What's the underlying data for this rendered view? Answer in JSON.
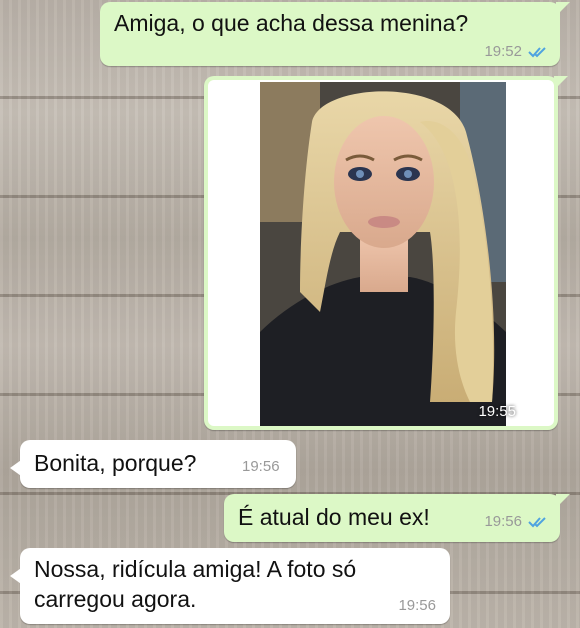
{
  "chat": {
    "messages": [
      {
        "direction": "outgoing",
        "text": "Amiga, o que acha dessa menina?",
        "time": "19:52",
        "status": "read"
      },
      {
        "direction": "outgoing",
        "type": "image",
        "image_description": "photo of a blonde woman",
        "time": "19:55",
        "status": "delivered"
      },
      {
        "direction": "incoming",
        "text": "Bonita, porque?",
        "time": "19:56"
      },
      {
        "direction": "outgoing",
        "text": "É atual do meu ex!",
        "time": "19:56",
        "status": "read"
      },
      {
        "direction": "incoming",
        "line1": "Nossa, ridícula amiga! A foto só",
        "line2": "carregou agora.",
        "time": "19:56"
      }
    ]
  },
  "colors": {
    "outgoing_bubble": "#dcf8c6",
    "incoming_bubble": "#ffffff",
    "read_ticks": "#4fa3e0",
    "delivered_ticks": "#ffffff"
  }
}
